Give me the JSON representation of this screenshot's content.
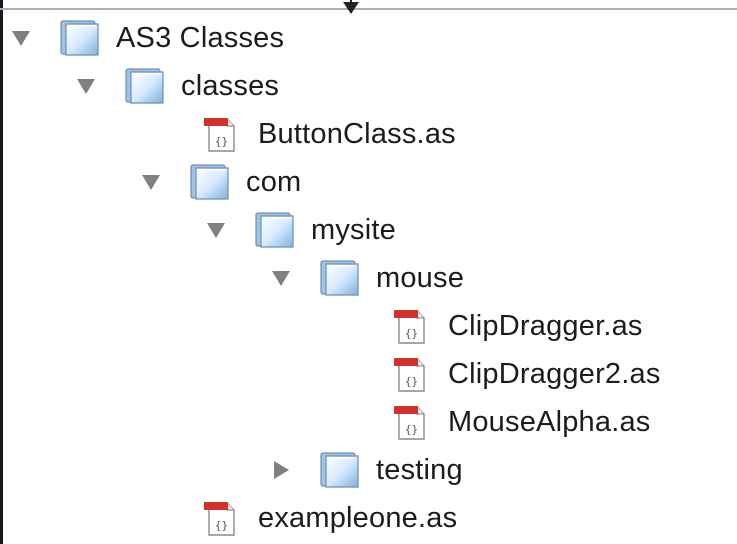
{
  "tree": [
    {
      "label": "AS3 Classes",
      "type": "folder",
      "state": "expanded",
      "level": 0
    },
    {
      "label": "classes",
      "type": "folder",
      "state": "expanded",
      "level": 1
    },
    {
      "label": "ButtonClass.as",
      "type": "file",
      "state": "none",
      "level": 2
    },
    {
      "label": "com",
      "type": "folder",
      "state": "expanded",
      "level": 2
    },
    {
      "label": "mysite",
      "type": "folder",
      "state": "expanded",
      "level": 3
    },
    {
      "label": "mouse",
      "type": "folder",
      "state": "expanded",
      "level": 4
    },
    {
      "label": "ClipDragger.as",
      "type": "file",
      "state": "none",
      "level": 5
    },
    {
      "label": "ClipDragger2.as",
      "type": "file",
      "state": "none",
      "level": 5
    },
    {
      "label": "MouseAlpha.as",
      "type": "file",
      "state": "none",
      "level": 5
    },
    {
      "label": "testing",
      "type": "folder",
      "state": "collapsed",
      "level": 4
    },
    {
      "label": "exampleone.as",
      "type": "file",
      "state": "none",
      "level": 2
    }
  ],
  "icons": {
    "folder": "folder-icon",
    "file": "actionscript-file-icon",
    "expanded": "disclosure-triangle-down-icon",
    "collapsed": "disclosure-triangle-right-icon"
  },
  "colors": {
    "triangle": "#808080",
    "folder_light": "#d7ebff",
    "folder_dark": "#7fb0dc",
    "file_red": "#d0312d"
  }
}
